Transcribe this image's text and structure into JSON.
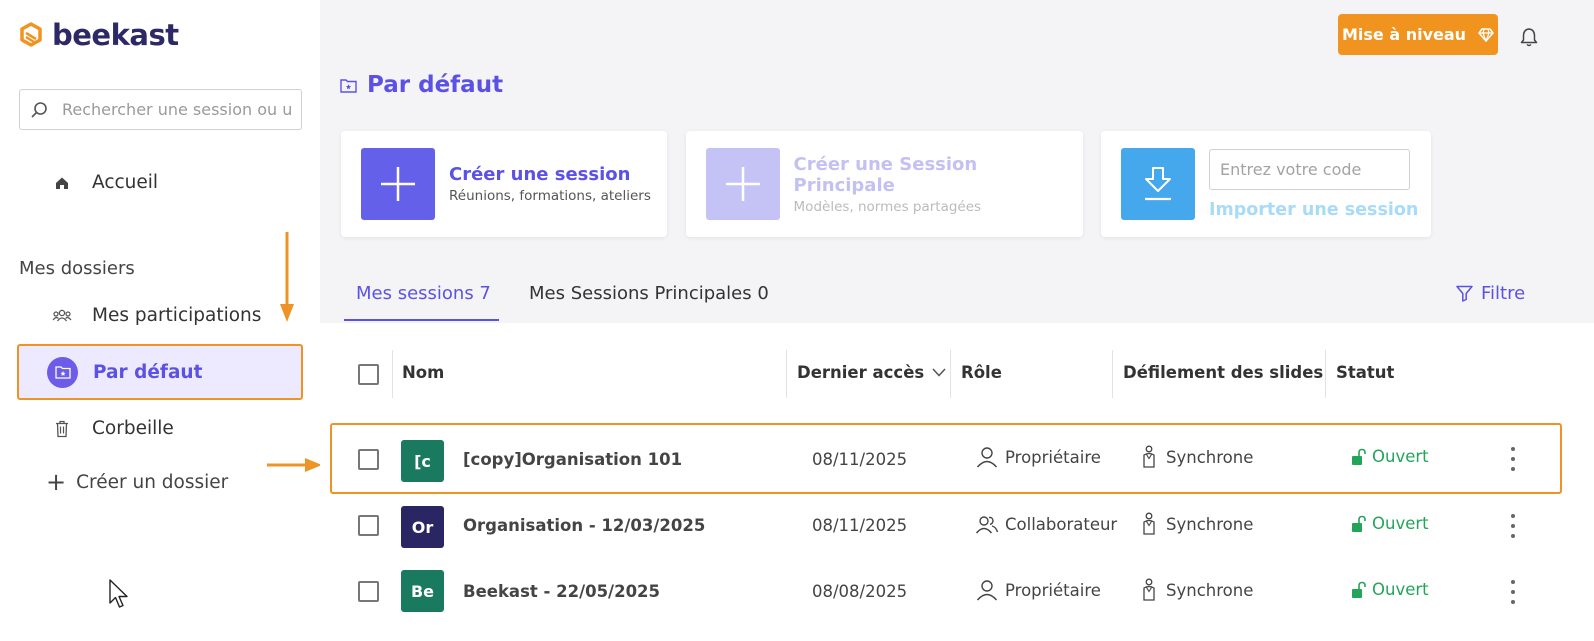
{
  "brand": {
    "name": "beekast",
    "accent": "#5b52e5",
    "orange": "#f0941f"
  },
  "search": {
    "placeholder": "Rechercher une session ou un dossier"
  },
  "sidebar": {
    "home": {
      "label": "Accueil",
      "icon": "home-icon"
    },
    "section_title": "Mes dossiers",
    "items": [
      {
        "label": "Mes participations",
        "icon": "users-icon"
      },
      {
        "label": "Par défaut",
        "icon": "folder-star-icon",
        "active": true
      },
      {
        "label": "Corbeille",
        "icon": "trash-icon"
      }
    ],
    "create_folder": "Créer un dossier"
  },
  "header": {
    "upgrade_label": "Mise à niveau",
    "upgrade_icon": "diamond-icon",
    "bell_icon": "bell-icon"
  },
  "page": {
    "title": "Par défaut"
  },
  "cards": {
    "create_session": {
      "title": "Créer une session",
      "subtitle": "Réunions, formations, ateliers"
    },
    "create_principal": {
      "title": "Créer une Session Principale",
      "subtitle": "Modèles, normes partagées"
    },
    "import": {
      "placeholder": "Entrez votre code",
      "link": "Importer une session"
    }
  },
  "tabs": [
    {
      "label": "Mes sessions 7",
      "active": true
    },
    {
      "label": "Mes Sessions Principales 0",
      "active": false
    }
  ],
  "filter_label": "Filtre",
  "table": {
    "columns": {
      "name": "Nom",
      "last_access": "Dernier accès",
      "role": "Rôle",
      "slides": "Défilement des slides",
      "status": "Statut"
    },
    "rows": [
      {
        "initials": "[c",
        "color": "#197a60",
        "name": "[copy]Organisation 101",
        "date": "08/11/2025",
        "role": "Propriétaire",
        "role_icon": "person-icon",
        "sync": "Synchrone",
        "status": "Ouvert"
      },
      {
        "initials": "Or",
        "color": "#2a2563",
        "name": "Organisation - 12/03/2025",
        "date": "08/11/2025",
        "role": "Collaborateur",
        "role_icon": "people-icon",
        "sync": "Synchrone",
        "status": "Ouvert"
      },
      {
        "initials": "Be",
        "color": "#197a60",
        "name": "Beekast - 22/05/2025",
        "date": "08/08/2025",
        "role": "Propriétaire",
        "role_icon": "person-icon",
        "sync": "Synchrone",
        "status": "Ouvert"
      }
    ]
  }
}
